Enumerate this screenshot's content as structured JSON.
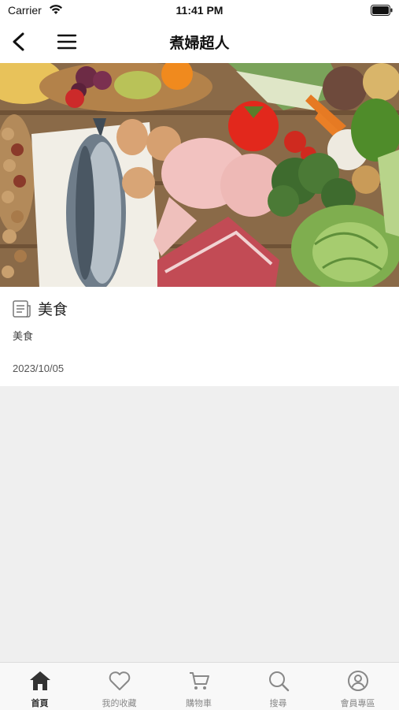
{
  "status_bar": {
    "carrier": "Carrier",
    "time": "11:41 PM",
    "icons": [
      "wifi-icon",
      "battery-icon"
    ]
  },
  "nav": {
    "title": "煮婦超人",
    "icons": [
      "back-arrow-icon",
      "hamburger-menu-icon"
    ]
  },
  "hero": {
    "icon": "vegetables-photo"
  },
  "post": {
    "icon": "news-article-icon",
    "title": "美食",
    "category": "美食",
    "date": "2023/10/05"
  },
  "tabs": [
    {
      "label": "首頁",
      "icon": "home-icon",
      "active": true
    },
    {
      "label": "我的收藏",
      "icon": "heart-icon",
      "active": false
    },
    {
      "label": "購物車",
      "icon": "cart-icon",
      "active": false
    },
    {
      "label": "搜尋",
      "icon": "search-icon",
      "active": false
    },
    {
      "label": "會員專區",
      "icon": "user-icon",
      "active": false
    }
  ],
  "colors": {
    "active_tab": "#333333",
    "inactive_tab": "#888888",
    "background": "#efefef"
  }
}
